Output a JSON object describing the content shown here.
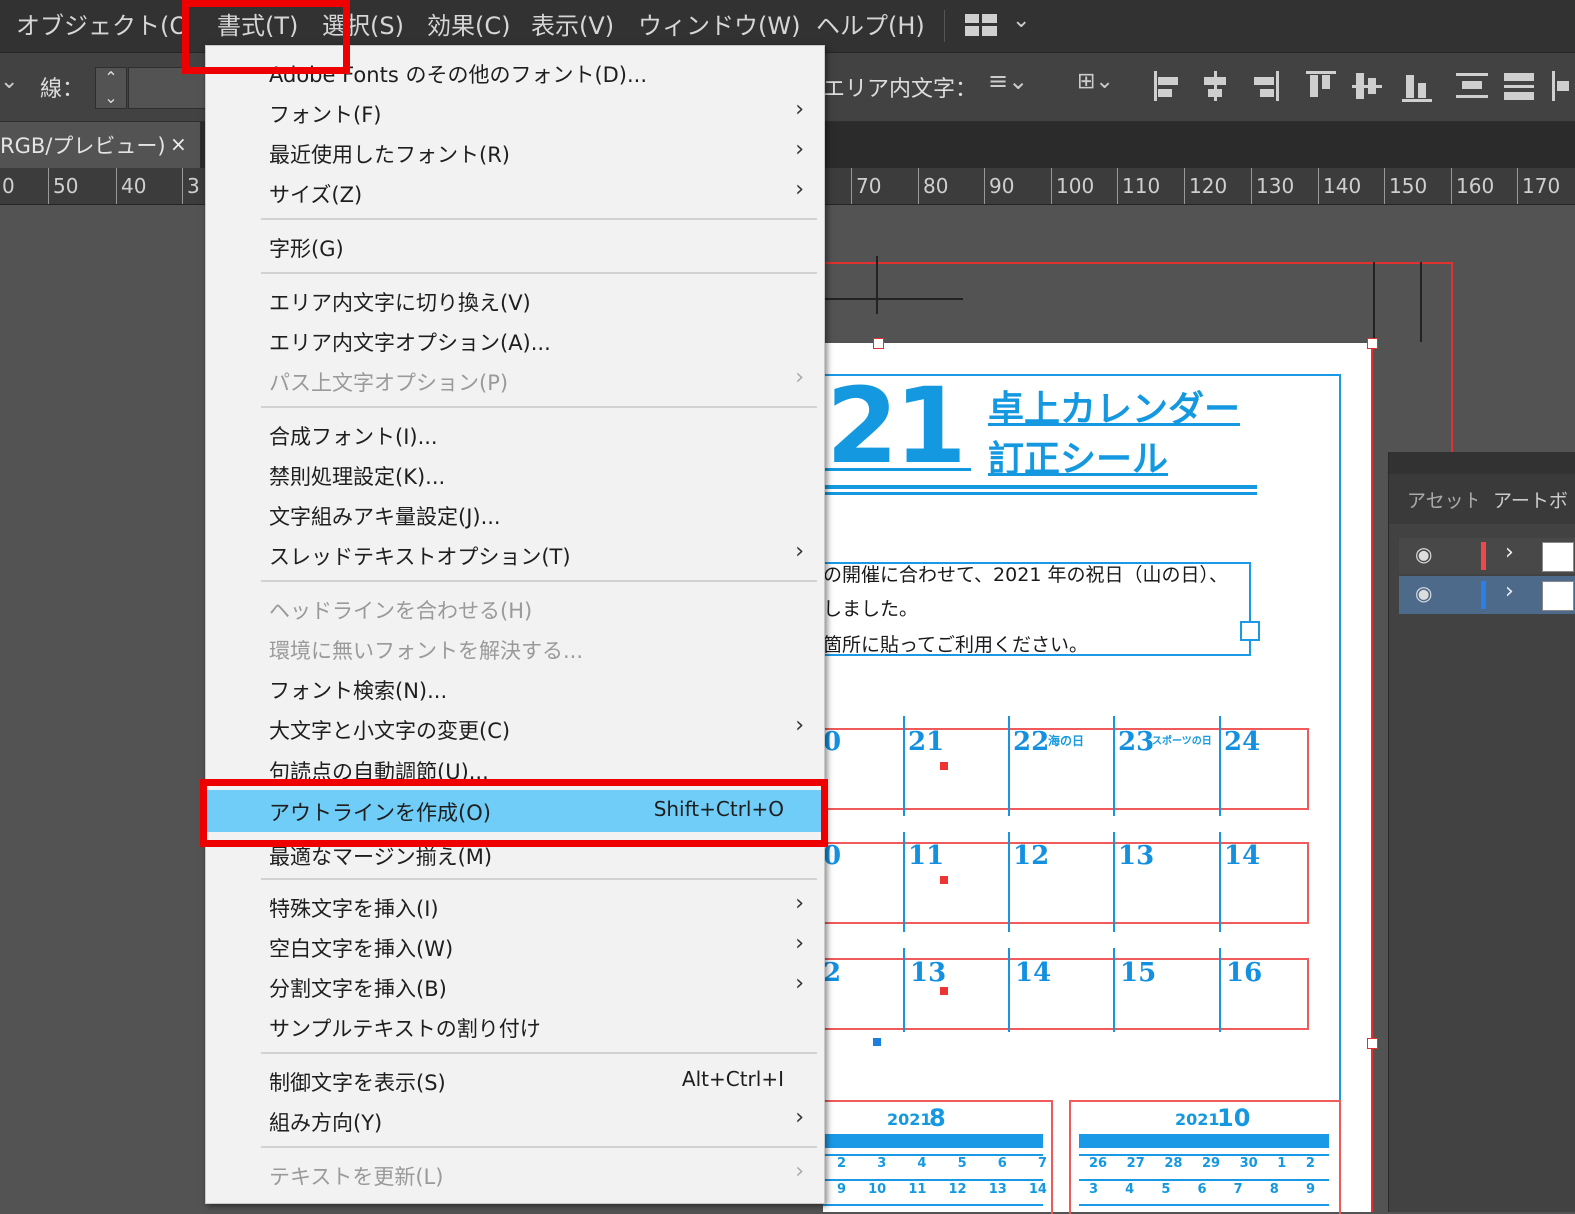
{
  "menubar": {
    "items": [
      "オブジェクト(O",
      "書式(T)",
      "選択(S)",
      "効果(C)",
      "表示(V)",
      "ウィンドウ(W)",
      "ヘルプ(H)"
    ]
  },
  "control": {
    "stroke_label": "線：",
    "area_text_label": "エリア内文字："
  },
  "tab": {
    "title": "RGB/プレビュー)",
    "close": "×"
  },
  "ruler": {
    "left_labels": [
      "0",
      "50",
      "40",
      "3"
    ],
    "right_labels": [
      "70",
      "80",
      "90",
      "100",
      "110",
      "120",
      "130",
      "140",
      "150",
      "160",
      "170"
    ]
  },
  "menu": {
    "items": [
      {
        "label": "Adobe Fonts のその他のフォント(D)...",
        "disabled": false
      },
      {
        "label": "フォント(F)",
        "arrow": true
      },
      {
        "label": "最近使用したフォント(R)",
        "arrow": true
      },
      {
        "label": "サイズ(Z)",
        "arrow": true
      },
      {
        "label": "字形(G)"
      },
      {
        "label": "エリア内文字に切り換え(V)"
      },
      {
        "label": "エリア内文字オプション(A)..."
      },
      {
        "label": "パス上文字オプション(P)",
        "arrow": true,
        "disabled": true
      },
      {
        "label": "合成フォント(I)..."
      },
      {
        "label": "禁則処理設定(K)..."
      },
      {
        "label": "文字組みアキ量設定(J)..."
      },
      {
        "label": "スレッドテキストオプション(T)",
        "arrow": true
      },
      {
        "label": "ヘッドラインを合わせる(H)",
        "disabled": true
      },
      {
        "label": "環境に無いフォントを解決する...",
        "disabled": true
      },
      {
        "label": "フォント検索(N)..."
      },
      {
        "label": "大文字と小文字の変更(C)",
        "arrow": true
      },
      {
        "label": "句読点の自動調節(U)..."
      },
      {
        "label": "アウトラインを作成(O)",
        "shortcut": "Shift+Ctrl+O",
        "highlighted": true
      },
      {
        "label": "最適なマージン揃え(M)"
      },
      {
        "label": "特殊文字を挿入(I)",
        "arrow": true
      },
      {
        "label": "空白文字を挿入(W)",
        "arrow": true
      },
      {
        "label": "分割文字を挿入(B)",
        "arrow": true
      },
      {
        "label": "サンプルテキストの割り付け"
      },
      {
        "label": "制御文字を表示(S)",
        "shortcut": "Alt+Ctrl+I"
      },
      {
        "label": "組み方向(Y)",
        "arrow": true
      },
      {
        "label": "テキストを更新(L)",
        "arrow": true,
        "disabled": true
      }
    ]
  },
  "document": {
    "year": "21",
    "title_line1": "卓上カレンダー",
    "title_line2": "訂正シール",
    "body_line1": "の開催に合わせて、2021 年の祝日（山の日）、",
    "body_line2": "しました。",
    "body_line3": "箇所に貼ってご利用ください。",
    "calendar_rows": [
      {
        "days": [
          "0",
          "21",
          "22",
          "23",
          "24"
        ],
        "notes": [
          "",
          "",
          "海の日",
          "スポーツの日",
          ""
        ]
      },
      {
        "days": [
          "0",
          "11",
          "12",
          "13",
          "14"
        ],
        "notes": [
          "",
          "",
          "",
          "",
          ""
        ]
      },
      {
        "days": [
          "2",
          "13",
          "14",
          "15",
          "16"
        ],
        "notes": [
          "",
          "",
          "",
          "",
          ""
        ]
      }
    ],
    "mini_cal_1": {
      "year": "2021",
      "month": "8",
      "row1": [
        "2",
        "3",
        "4",
        "5",
        "6",
        "7"
      ],
      "row2": [
        "9",
        "10",
        "11",
        "12",
        "13",
        "14"
      ]
    },
    "mini_cal_2": {
      "year": "2021",
      "month": "10",
      "row1": [
        "26",
        "27",
        "28",
        "29",
        "30",
        "1",
        "2"
      ],
      "row2": [
        "3",
        "4",
        "5",
        "6",
        "7",
        "8",
        "9"
      ]
    }
  },
  "panel": {
    "tabs": [
      "アセット(",
      "アートボ"
    ]
  },
  "colors": {
    "highlight": "#6fcdf7",
    "annotation_red": "#ee0000",
    "doc_blue": "#1499e0"
  }
}
